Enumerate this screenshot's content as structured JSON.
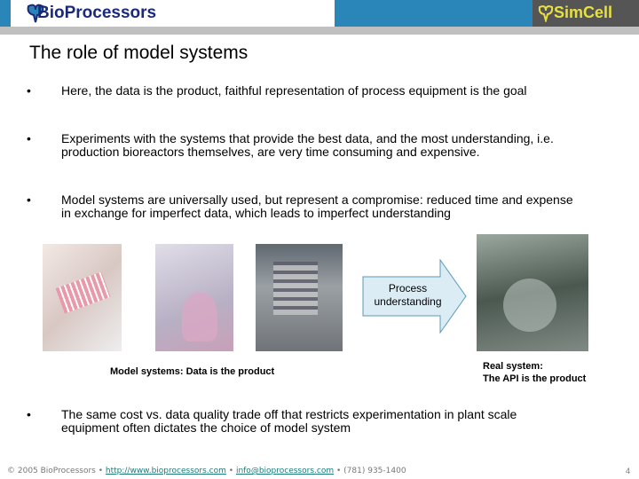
{
  "header": {
    "left_logo": "BioProcessors",
    "right_logo": "SimCell"
  },
  "title": "The role of model systems",
  "bullets": [
    "Here, the data is the product, faithful representation of process equipment is the goal",
    "Experiments with the systems that provide the best data, and the most understanding, i.e. production bioreactors themselves, are very time consuming and expensive.",
    "Model systems are universally used, but represent a compromise: reduced time and expense in exchange for imperfect data, which leads to imperfect understanding",
    "The same cost vs. data quality trade off that restricts experimentation in plant scale equipment often dictates the choice of model system"
  ],
  "bullet_char": "•",
  "arrow_label": "Process understanding",
  "caption_model": "Model systems: Data is the product",
  "caption_real_1": "Real system:",
  "caption_real_2": "The API is the product",
  "footer": {
    "copyright": "© 2005 BioProcessors •",
    "url": "http://www.bioprocessors.com",
    "sep": "•",
    "email": "info@bioprocessors.com",
    "phone": "• (781) 935-1400"
  },
  "page_number": "4"
}
